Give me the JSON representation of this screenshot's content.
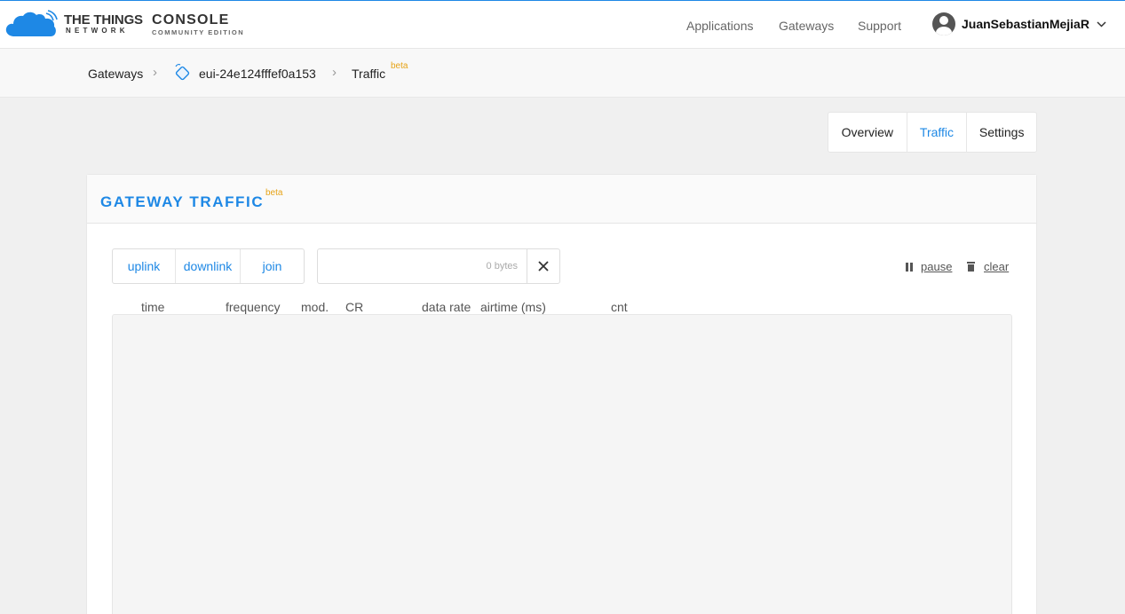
{
  "brand": {
    "name_line1": "THE THINGS",
    "name_line2": "NETWORK",
    "console_title": "CONSOLE",
    "console_edition": "COMMUNITY EDITION",
    "cloud_color": "#1e88e5"
  },
  "nav": {
    "applications": "Applications",
    "gateways": "Gateways",
    "support": "Support"
  },
  "user": {
    "name": "JuanSebastianMejiaR",
    "avatar_icon": "user-avatar-icon",
    "menu_icon": "chevron-down-icon"
  },
  "breadcrumb": {
    "gateways": "Gateways",
    "gateway_id": "eui-24e124fffef0a153",
    "gateway_icon": "gateway-tag-icon",
    "traffic": "Traffic",
    "traffic_badge": "beta"
  },
  "tabs": {
    "overview": "Overview",
    "traffic": "Traffic",
    "settings": "Settings",
    "active": "Traffic"
  },
  "card": {
    "title": "GATEWAY TRAFFIC",
    "badge": "beta"
  },
  "filters": {
    "uplink": "uplink",
    "downlink": "downlink",
    "join": "join"
  },
  "search": {
    "placeholder": "0 bytes",
    "clear_icon": "close-icon"
  },
  "controls": {
    "pause": "pause",
    "clear": "clear"
  },
  "table": {
    "columns": [
      "time",
      "frequency",
      "mod.",
      "CR",
      "data rate",
      "airtime (ms)",
      "cnt"
    ],
    "rows": []
  },
  "colors": {
    "accent": "#1e88e5",
    "beta": "#e6a317"
  }
}
